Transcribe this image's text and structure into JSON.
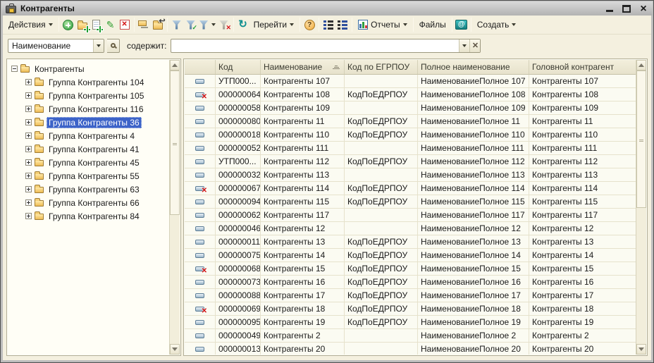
{
  "window": {
    "title": "Контрагенты"
  },
  "window_controls": {
    "close_glyph": "×"
  },
  "toolbar": {
    "actions_label": "Действия",
    "goto_label": "Перейти",
    "reports_label": "Отчеты",
    "files_label": "Файлы",
    "create_label": "Создать"
  },
  "icons": {
    "edit_glyph": "✎",
    "delete_glyph": "✕",
    "deleted_mark": "✕",
    "check_glyph": "✓",
    "refresh_glyph": "↻",
    "help_glyph": "?",
    "at_glyph": "@",
    "move_arrow_glyph": "↩",
    "clear_glyph": "✕"
  },
  "filter": {
    "field_value": "Наименование",
    "contains_label": "содержит:",
    "input_value": "",
    "input_placeholder": ""
  },
  "tree": {
    "root_label": "Контрагенты",
    "groups": [
      {
        "label": "Группа Контрагенты 104",
        "selected": false
      },
      {
        "label": "Группа Контрагенты 105",
        "selected": false
      },
      {
        "label": "Группа Контрагенты 116",
        "selected": false
      },
      {
        "label": "Группа Контрагенты 36",
        "selected": true
      },
      {
        "label": "Группа Контрагенты 4",
        "selected": false
      },
      {
        "label": "Группа Контрагенты 41",
        "selected": false
      },
      {
        "label": "Группа Контрагенты 45",
        "selected": false
      },
      {
        "label": "Группа Контрагенты 55",
        "selected": false
      },
      {
        "label": "Группа Контрагенты 63",
        "selected": false
      },
      {
        "label": "Группа Контрагенты 66",
        "selected": false
      },
      {
        "label": "Группа Контрагенты 84",
        "selected": false
      }
    ]
  },
  "table": {
    "columns": [
      "",
      "Код",
      "Наименование",
      "Код по ЕГРПОУ",
      "Полное наименование",
      "Головной контрагент"
    ],
    "rows": [
      {
        "code": "УТП000...",
        "name": "Контрагенты 107",
        "egrpou": "",
        "full": "НаименованиеПолное 107",
        "head": "Контрагенты 107",
        "deleted": false
      },
      {
        "code": "000000064",
        "name": "Контрагенты 108",
        "egrpou": "КодПоЕДРПОУ",
        "full": "НаименованиеПолное 108",
        "head": "Контрагенты 108",
        "deleted": true
      },
      {
        "code": "000000058",
        "name": "Контрагенты 109",
        "egrpou": "",
        "full": "НаименованиеПолное 109",
        "head": "Контрагенты 109",
        "deleted": false
      },
      {
        "code": "000000080",
        "name": "Контрагенты 11",
        "egrpou": "КодПоЕДРПОУ",
        "full": "НаименованиеПолное 11",
        "head": "Контрагенты 11",
        "deleted": false
      },
      {
        "code": "000000018",
        "name": "Контрагенты 110",
        "egrpou": "КодПоЕДРПОУ",
        "full": "НаименованиеПолное 110",
        "head": "Контрагенты 110",
        "deleted": false
      },
      {
        "code": "000000052",
        "name": "Контрагенты 111",
        "egrpou": "",
        "full": "НаименованиеПолное 111",
        "head": "Контрагенты 111",
        "deleted": false
      },
      {
        "code": "УТП000...",
        "name": "Контрагенты 112",
        "egrpou": "КодПоЕДРПОУ",
        "full": "НаименованиеПолное 112",
        "head": "Контрагенты 112",
        "deleted": false
      },
      {
        "code": "000000032",
        "name": "Контрагенты 113",
        "egrpou": "",
        "full": "НаименованиеПолное 113",
        "head": "Контрагенты 113",
        "deleted": false
      },
      {
        "code": "000000067",
        "name": "Контрагенты 114",
        "egrpou": "КодПоЕДРПОУ",
        "full": "НаименованиеПолное 114",
        "head": "Контрагенты 114",
        "deleted": true
      },
      {
        "code": "000000094",
        "name": "Контрагенты 115",
        "egrpou": "КодПоЕДРПОУ",
        "full": "НаименованиеПолное 115",
        "head": "Контрагенты 115",
        "deleted": false
      },
      {
        "code": "000000062",
        "name": "Контрагенты 117",
        "egrpou": "",
        "full": "НаименованиеПолное 117",
        "head": "Контрагенты 117",
        "deleted": false
      },
      {
        "code": "000000046",
        "name": "Контрагенты 12",
        "egrpou": "",
        "full": "НаименованиеПолное 12",
        "head": "Контрагенты 12",
        "deleted": false
      },
      {
        "code": "000000011",
        "name": "Контрагенты 13",
        "egrpou": "КодПоЕДРПОУ",
        "full": "НаименованиеПолное 13",
        "head": "Контрагенты 13",
        "deleted": false
      },
      {
        "code": "000000075",
        "name": "Контрагенты 14",
        "egrpou": "КодПоЕДРПОУ",
        "full": "НаименованиеПолное 14",
        "head": "Контрагенты 14",
        "deleted": false
      },
      {
        "code": "000000068",
        "name": "Контрагенты 15",
        "egrpou": "КодПоЕДРПОУ",
        "full": "НаименованиеПолное 15",
        "head": "Контрагенты 15",
        "deleted": true
      },
      {
        "code": "000000073",
        "name": "Контрагенты 16",
        "egrpou": "КодПоЕДРПОУ",
        "full": "НаименованиеПолное 16",
        "head": "Контрагенты 16",
        "deleted": false
      },
      {
        "code": "000000088",
        "name": "Контрагенты 17",
        "egrpou": "КодПоЕДРПОУ",
        "full": "НаименованиеПолное 17",
        "head": "Контрагенты 17",
        "deleted": false
      },
      {
        "code": "000000069",
        "name": "Контрагенты 18",
        "egrpou": "КодПоЕДРПОУ",
        "full": "НаименованиеПолное 18",
        "head": "Контрагенты 18",
        "deleted": true
      },
      {
        "code": "000000095",
        "name": "Контрагенты 19",
        "egrpou": "КодПоЕДРПОУ",
        "full": "НаименованиеПолное 19",
        "head": "Контрагенты 19",
        "deleted": false
      },
      {
        "code": "000000049",
        "name": "Контрагенты 2",
        "egrpou": "",
        "full": "НаименованиеПолное 2",
        "head": "Контрагенты 2",
        "deleted": false
      },
      {
        "code": "000000013",
        "name": "Контрагенты 20",
        "egrpou": "",
        "full": "НаименованиеПолное 20",
        "head": "Контрагенты 20",
        "deleted": false
      }
    ]
  },
  "colors": {
    "selection": "#3c63c8",
    "panel_background": "#f4f0df",
    "deleted_mark": "#d01010",
    "titlebar": "#c4c4c4"
  }
}
